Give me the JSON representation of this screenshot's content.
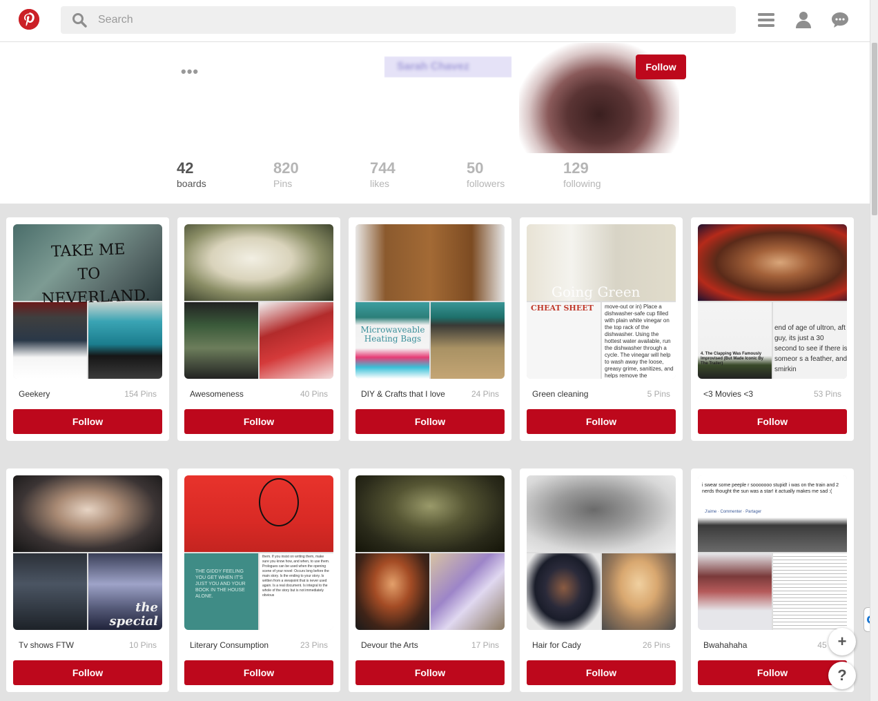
{
  "header": {
    "logo_name": "pinterest-logo",
    "search_placeholder": "Search",
    "icons": [
      "menu-icon",
      "profile-icon",
      "messages-icon"
    ]
  },
  "profile": {
    "more_label": "•••",
    "name_blurred": "Sarah Chavez",
    "follow_label": "Follow",
    "stats": [
      {
        "value": "42",
        "label": "boards"
      },
      {
        "value": "820",
        "label": "Pins"
      },
      {
        "value": "744",
        "label": "likes"
      },
      {
        "value": "50",
        "label": "followers"
      },
      {
        "value": "129",
        "label": "following"
      }
    ]
  },
  "boards": [
    {
      "title": "Geekery",
      "count": "154",
      "pins_label": "Pins",
      "follow_label": "Follow"
    },
    {
      "title": "Awesomeness",
      "count": "40",
      "pins_label": "Pins",
      "follow_label": "Follow"
    },
    {
      "title": "DIY & Crafts that I love",
      "count": "24",
      "pins_label": "Pins",
      "follow_label": "Follow"
    },
    {
      "title": "Green cleaning",
      "count": "5",
      "pins_label": "Pins",
      "follow_label": "Follow"
    },
    {
      "title": "<3 Movies <3",
      "count": "53",
      "pins_label": "Pins",
      "follow_label": "Follow"
    },
    {
      "title": "Tv shows FTW",
      "count": "10",
      "pins_label": "Pins",
      "follow_label": "Follow"
    },
    {
      "title": "Literary Consumption",
      "count": "23",
      "pins_label": "Pins",
      "follow_label": "Follow"
    },
    {
      "title": "Devour the Arts",
      "count": "17",
      "pins_label": "Pins",
      "follow_label": "Follow"
    },
    {
      "title": "Hair for Cady",
      "count": "26",
      "pins_label": "Pins",
      "follow_label": "Follow"
    },
    {
      "title": "Bwahahaha",
      "count": "45",
      "pins_label": "P",
      "follow_label": "Follow"
    }
  ],
  "covers": {
    "geekery": {
      "big_text": "TAKE ME TO NEVERLAND."
    },
    "green": {
      "big_text": "Going Green",
      "sheet_text": "CHEAT SHEET",
      "side_text": "move-out or in) Place a dishwasher-safe cup filled with plain white vinegar on the top rack of the dishwasher. Using the hottest water available, run the dishwasher through a cycle. The vinegar will help to wash away the loose, greasy grime, sanitizes, and helps remove the"
    },
    "movies": {
      "side_text": "end of age of ultron, aft guy, its just a 30 second to see if there is someor s a feather, and smirkin",
      "caption": "4. The Clapping Was Famously Improvised (But Made Iconic By The Trailer)"
    },
    "diy": {
      "label": "Microwaveable Heating Bags"
    },
    "tv": {
      "label": "the special"
    },
    "literary": {
      "left_text": "THE GIDDY FEELING YOU GET WHEN IT'S JUST YOU AND YOUR BOOK IN THE HOUSE ALONE.",
      "right_text": "them. If you insist on writing them, make sure you know how, and when, to use them. Prologues can be used when the opening scene of your novel: Occurs long before the main story. Is the ending to your story. Is written from a viewpoint that is never used again. Is a real document. Is integral to the whole of the story but is not immediately obvious"
    },
    "bwahahaha": {
      "top_text": "i swear some peeple r sooooooo stupid! i was on the train and 2 nerds thought the sun was a star! it actually makes me sad :(",
      "actions": "J'aime · Commenter · Partager"
    }
  },
  "floating": {
    "plus": "+",
    "help": "?"
  }
}
